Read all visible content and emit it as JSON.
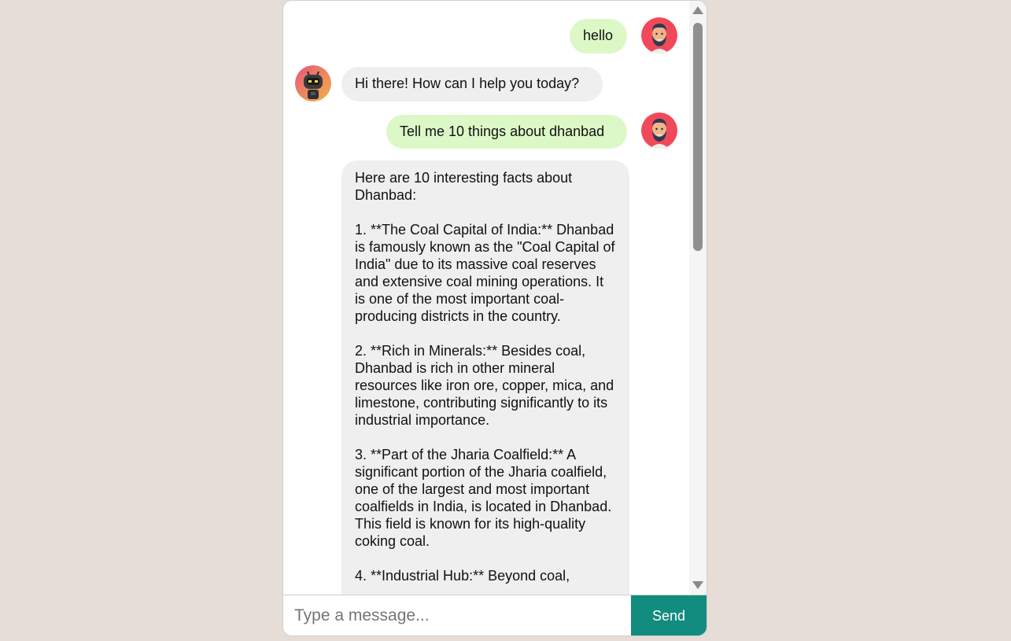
{
  "messages": [
    {
      "sender": "user",
      "text": "hello"
    },
    {
      "sender": "bot",
      "text": "Hi there! How can I help you today?"
    },
    {
      "sender": "user",
      "text": "Tell me 10 things about dhanbad"
    },
    {
      "sender": "bot",
      "text": "Here are 10 interesting facts about Dhanbad:\n\n1. **The Coal Capital of India:** Dhanbad is famously known as the \"Coal Capital of India\" due to its massive coal reserves and extensive coal mining operations. It is one of the most important coal-producing districts in the country.\n\n2. **Rich in Minerals:** Besides coal, Dhanbad is rich in other mineral resources like iron ore, copper, mica, and limestone, contributing significantly to its industrial importance.\n\n3. **Part of the Jharia Coalfield:** A significant portion of the Jharia coalfield, one of the largest and most important coalfields in India, is located in Dhanbad. This field is known for its high-quality coking coal.\n\n4. **Industrial Hub:** Beyond coal,"
    }
  ],
  "composer": {
    "placeholder": "Type a message...",
    "value": "",
    "send_label": "Send"
  },
  "colors": {
    "page_background": "#e5ddd6",
    "user_bubble": "#dcf8c6",
    "bot_bubble": "#efefef",
    "send_button": "#128c7e"
  },
  "icons": {
    "user_avatar": "bearded-man-avatar-icon",
    "bot_avatar": "robot-avatar-icon"
  }
}
